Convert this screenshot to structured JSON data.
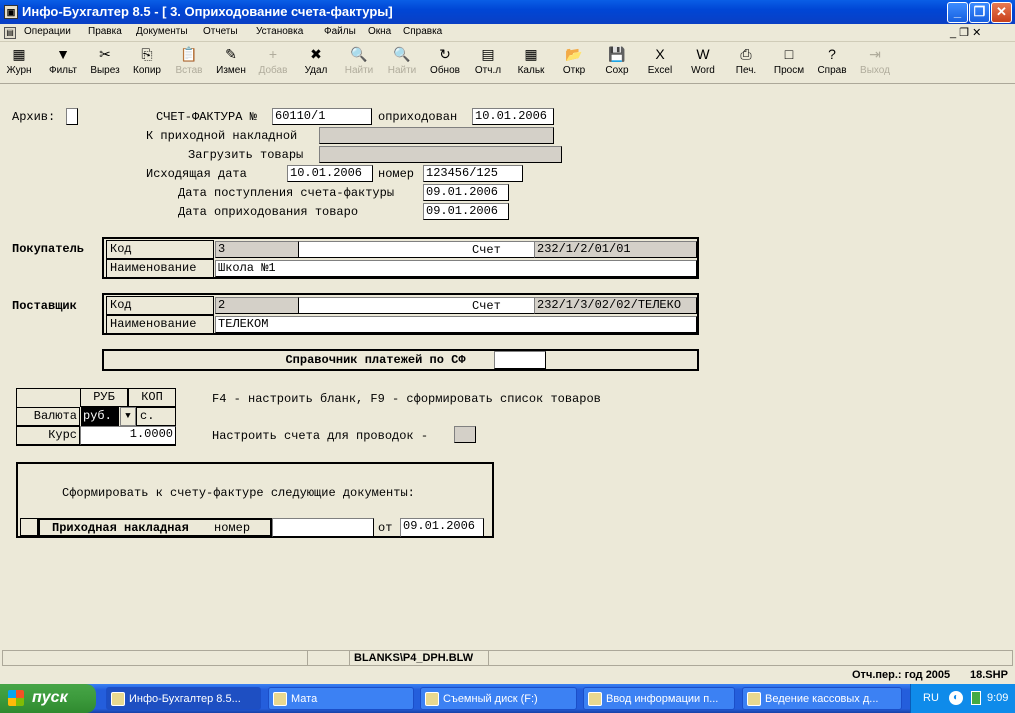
{
  "window": {
    "title": "Инфо-Бухгалтер 8.5 - [ 3. Оприходование счета-фактуры]",
    "minimize": "_",
    "restore": "❐",
    "close": "✕",
    "mdi_controls": "_ ❐ ✕"
  },
  "menu": [
    "Операции",
    "Правка",
    "Документы",
    "Отчеты",
    "Установка",
    "Файлы",
    "Окна",
    "Справка"
  ],
  "toolbar": [
    {
      "label": "Журн",
      "icon": "journal-icon",
      "glyph": "▦",
      "disabled": false
    },
    {
      "label": "Фильт",
      "icon": "filter-icon",
      "glyph": "▼",
      "disabled": false
    },
    {
      "label": "Вырез",
      "icon": "scissors-icon",
      "glyph": "✂",
      "disabled": false
    },
    {
      "label": "Копир",
      "icon": "copy-icon",
      "glyph": "⎘",
      "disabled": false
    },
    {
      "label": "Встав",
      "icon": "paste-icon",
      "glyph": "📋",
      "disabled": true
    },
    {
      "label": "Измен",
      "icon": "edit-icon",
      "glyph": "✎",
      "disabled": false
    },
    {
      "label": "Добав",
      "icon": "add-icon",
      "glyph": "+",
      "disabled": true
    },
    {
      "label": "Удал",
      "icon": "delete-icon",
      "glyph": "✖",
      "disabled": false
    },
    {
      "label": "Найти",
      "icon": "find-icon",
      "glyph": "🔍",
      "disabled": true
    },
    {
      "label": "Найти",
      "icon": "find-next-icon",
      "glyph": "🔍",
      "disabled": true
    },
    {
      "label": "Обнов",
      "icon": "refresh-icon",
      "glyph": "↻",
      "disabled": false
    },
    {
      "label": "Отч.л",
      "icon": "report-icon",
      "glyph": "▤",
      "disabled": false
    },
    {
      "label": "Кальк",
      "icon": "calculator-icon",
      "glyph": "▦",
      "disabled": false
    },
    {
      "label": "Откр",
      "icon": "open-icon",
      "glyph": "📂",
      "disabled": false
    },
    {
      "label": "Сохр",
      "icon": "save-icon",
      "glyph": "💾",
      "disabled": false
    },
    {
      "label": "Excel",
      "icon": "excel-icon",
      "glyph": "X",
      "disabled": false
    },
    {
      "label": "Word",
      "icon": "word-icon",
      "glyph": "W",
      "disabled": false
    },
    {
      "label": "Печ.",
      "icon": "print-icon",
      "glyph": "⎙",
      "disabled": false
    },
    {
      "label": "Просм",
      "icon": "preview-icon",
      "glyph": "□",
      "disabled": false
    },
    {
      "label": "Справ",
      "icon": "help-icon",
      "glyph": "?",
      "disabled": false
    },
    {
      "label": "Выход",
      "icon": "exit-icon",
      "glyph": "⇥",
      "disabled": true
    }
  ],
  "form": {
    "archive_label": "Архив:",
    "invoice_label": "СЧЕТ-ФАКТУРА №",
    "invoice_number": "60110/1",
    "posted_label": "оприходован",
    "posted_date": "10.01.2006",
    "to_receipt_label": "К приходной накладной",
    "to_receipt_value": "",
    "load_goods_label": "Загрузить товары",
    "load_goods_value": "",
    "outgoing_date_label": "Исходящая дата",
    "outgoing_date": "10.01.2006",
    "number_label": "номер",
    "number_value": "123456/125",
    "receipt_date_label": "Дата поступления счета-фактуры",
    "receipt_date": "09.01.2006",
    "goods_posted_label": "Дата оприходования товаро",
    "goods_posted_date": "09.01.2006"
  },
  "buyer": {
    "section": "Покупатель",
    "code_label": "Код",
    "code": "3",
    "account_label": "Счет",
    "account": "232/1/2/01/01",
    "name_label": "Наименование",
    "name": "Школа №1"
  },
  "supplier": {
    "section": "Поставщик",
    "code_label": "Код",
    "code": "2",
    "account_label": "Счет",
    "account": "232/1/3/02/02/ТЕЛЕКО",
    "name_label": "Наименование",
    "name": "ТЕЛЕКОМ"
  },
  "payments_button": "Справочник платежей по СФ",
  "currency": {
    "col_rub": "РУБ",
    "col_kop": "КОП",
    "currency_label": "Валюта",
    "currency_value": "руб.",
    "kop_value": "с.",
    "rate_label": "Курс",
    "rate_value": "1.0000"
  },
  "hint_text": "F4 - настроить бланк, F9 - сформировать список товаров",
  "accounts_label": "Настроить счета для проводок -",
  "docs": {
    "title": "Сформировать к счету-фактуре следующие документы:",
    "doc_name": "Приходная накладная",
    "number_label": "номер",
    "number_value": "",
    "from_label": "от",
    "from_date": "09.01.2006"
  },
  "status": {
    "blank": "BLANKS\\P4_DPH.BLW",
    "period": "Отч.пер.: год 2005",
    "shp": "18.SHP"
  },
  "taskbar": {
    "start": "пуск",
    "tasks": [
      {
        "label": "Инфо-Бухгалтер 8.5...",
        "active": true
      },
      {
        "label": "Мата",
        "active": false
      },
      {
        "label": "Съемный диск (F:)",
        "active": false
      },
      {
        "label": "Ввод информации п...",
        "active": false
      },
      {
        "label": "Ведение кассовых д...",
        "active": false
      }
    ],
    "lang": "RU",
    "time": "9:09"
  }
}
